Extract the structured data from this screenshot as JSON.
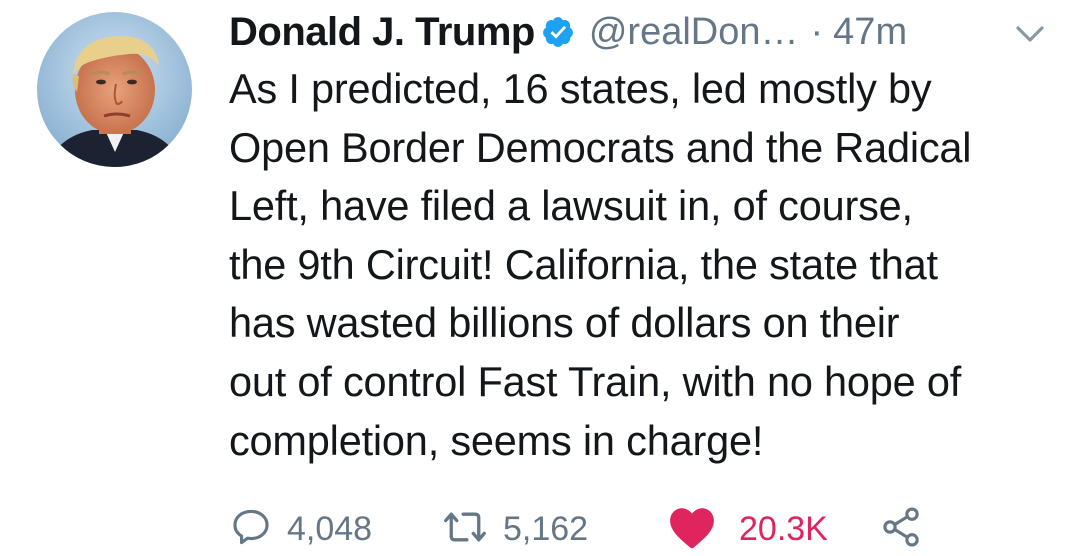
{
  "tweet": {
    "author": {
      "display_name": "Donald J. Trump",
      "handle": "@realDon…",
      "verified_icon": "verified-badge-icon",
      "avatar_icon": "profile-photo"
    },
    "separator": "·",
    "timestamp": "47m",
    "menu_icon": "chevron-down-icon",
    "text_lines": [
      "As I predicted, 16 states, led mostly by",
      "Open Border Democrats and the Radical",
      "Left, have filed a lawsuit in, of course,",
      "the 9th Circuit! California, the state that",
      "has wasted billions of dollars on their",
      "out of control Fast Train, with no hope of",
      "completion, seems in charge!"
    ],
    "actions": {
      "reply": {
        "icon": "reply-bubble-icon",
        "count": "4,048"
      },
      "retweet": {
        "icon": "retweet-icon",
        "count": "5,162"
      },
      "like": {
        "icon": "heart-icon",
        "count": "20.3K",
        "liked": true
      },
      "share": {
        "icon": "share-icon"
      }
    }
  },
  "colors": {
    "text": "#14171a",
    "secondary": "#657786",
    "verified": "#1da1f2",
    "like": "#e0245e"
  }
}
